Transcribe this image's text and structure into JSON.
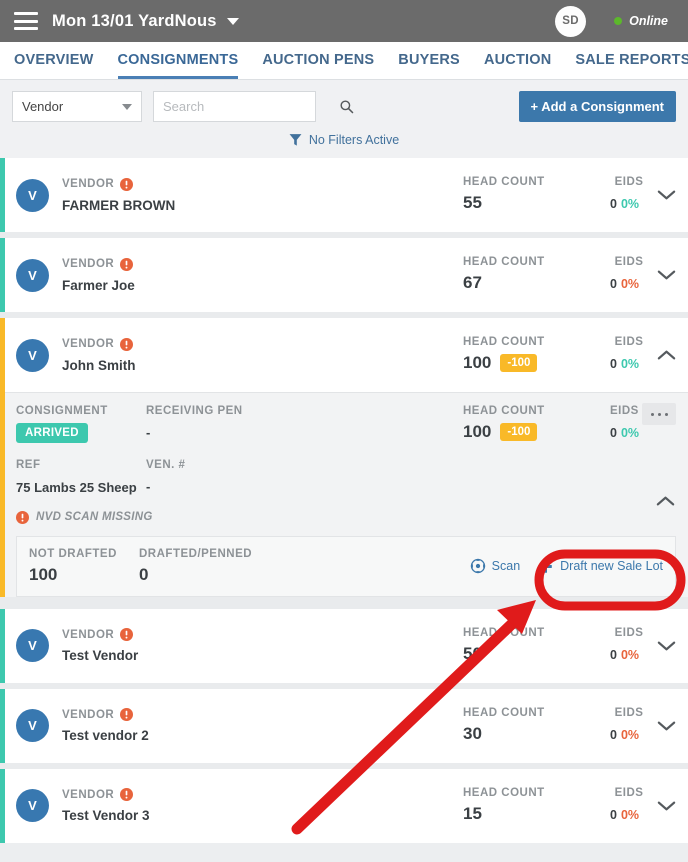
{
  "topbar": {
    "menu_icon": "hamburger-icon",
    "title": "Mon 13/01 YardNous",
    "dropdown_icon": "chevron-down-icon",
    "avatar_initials": "SD",
    "status_text": "Online",
    "status_color": "#5cb82b"
  },
  "tabs": [
    {
      "label": "OVERVIEW",
      "active": false
    },
    {
      "label": "CONSIGNMENTS",
      "active": true
    },
    {
      "label": "AUCTION PENS",
      "active": false
    },
    {
      "label": "BUYERS",
      "active": false
    },
    {
      "label": "AUCTION",
      "active": false
    },
    {
      "label": "SALE REPORTS",
      "active": false
    }
  ],
  "filterbar": {
    "vendor_select_value": "Vendor",
    "search_placeholder": "Search",
    "search_value": "",
    "search_icon": "search-icon",
    "add_button_label": "+ Add a Consignment",
    "filters_icon": "funnel-icon",
    "filters_text": "No Filters Active"
  },
  "labels": {
    "vendor": "VENDOR",
    "head_count": "HEAD COUNT",
    "eids": "EIDS",
    "consignment": "CONSIGNMENT",
    "receiving_pen": "RECEIVING PEN",
    "ref": "REF",
    "ven_no": "VEN. #",
    "not_drafted": "NOT DRAFTED",
    "drafted_penned": "DRAFTED/PENNED",
    "avatar_letter": "V"
  },
  "colors": {
    "accent_blue": "#3c78ab",
    "teal": "#3dc8ae",
    "amber": "#f9b928",
    "red": "#e8643c",
    "annotation_red": "#e01b1b"
  },
  "vendors": [
    {
      "name": "FARMER BROWN",
      "head_count": "55",
      "head_badge": "",
      "eids_count": "0",
      "eids_pct": "0%",
      "eids_pct_color": "green",
      "expanded": false,
      "chevron": "chevron-down-icon"
    },
    {
      "name": "Farmer Joe",
      "head_count": "67",
      "head_badge": "",
      "eids_count": "0",
      "eids_pct": "0%",
      "eids_pct_color": "red",
      "expanded": false,
      "chevron": "chevron-down-icon"
    },
    {
      "name": "John Smith",
      "head_count": "100",
      "head_badge": "-100",
      "eids_count": "0",
      "eids_pct": "0%",
      "eids_pct_color": "green",
      "expanded": true,
      "chevron": "chevron-up-icon"
    },
    {
      "name": "Test Vendor",
      "head_count": "50",
      "head_badge": "",
      "eids_count": "0",
      "eids_pct": "0%",
      "eids_pct_color": "red",
      "expanded": false,
      "chevron": "chevron-down-icon"
    },
    {
      "name": "Test vendor 2",
      "head_count": "30",
      "head_badge": "",
      "eids_count": "0",
      "eids_pct": "0%",
      "eids_pct_color": "red",
      "expanded": false,
      "chevron": "chevron-down-icon"
    },
    {
      "name": "Test Vendor 3",
      "head_count": "15",
      "head_badge": "",
      "eids_count": "0",
      "eids_pct": "0%",
      "eids_pct_color": "red",
      "expanded": false,
      "chevron": "chevron-down-icon"
    }
  ],
  "consignment": {
    "status_badge": "ARRIVED",
    "receiving_pen_value": "-",
    "head_count": "100",
    "head_badge": "-100",
    "eids_count": "0",
    "eids_pct": "0%",
    "ref_value": "75 Lambs 25 Sheep",
    "ven_no_value": "-",
    "warning_text": "NVD SCAN MISSING",
    "not_drafted_value": "100",
    "drafted_penned_value": "0",
    "scan_label": "Scan",
    "scan_icon": "scan-target-icon",
    "draft_label": "Draft new Sale Lot",
    "draft_icon": "plus-icon",
    "more_icon": "ellipsis-icon",
    "collapse_icon": "chevron-up-icon"
  },
  "annotation": {
    "highlight_shape": "rounded-rect-ring",
    "pointer_shape": "arrow",
    "color": "#e01b1b"
  }
}
